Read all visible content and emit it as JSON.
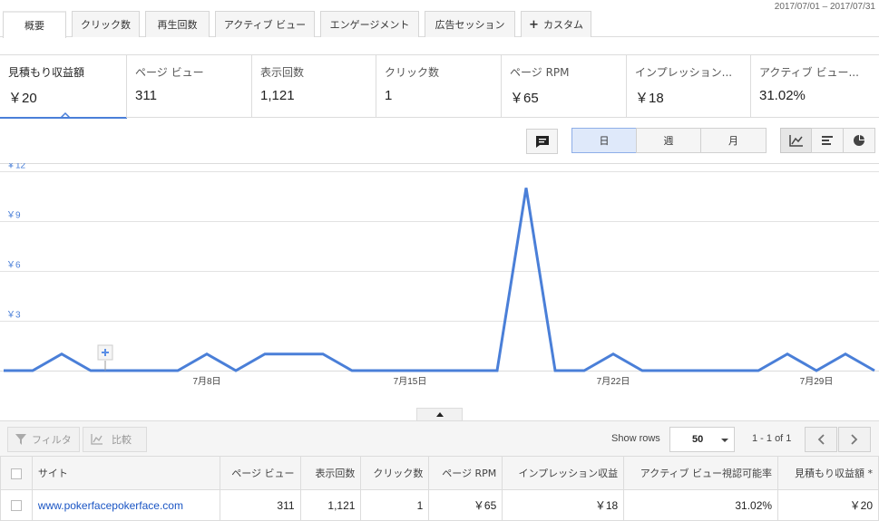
{
  "date_range": "2017/07/01 – 2017/07/31",
  "tabs": [
    {
      "label": "概要",
      "active": true
    },
    {
      "label": "クリック数"
    },
    {
      "label": "再生回数"
    },
    {
      "label": "アクティブ ビュー"
    },
    {
      "label": "エンゲージメント"
    },
    {
      "label": "広告セッション"
    },
    {
      "label": "カスタム",
      "icon": "plus-icon"
    }
  ],
  "metrics": [
    {
      "label": "見積もり収益額",
      "value": "￥20",
      "active": true
    },
    {
      "label": "ページ ビュー",
      "value": "311"
    },
    {
      "label": "表示回数",
      "value": "1,121"
    },
    {
      "label": "クリック数",
      "value": "1"
    },
    {
      "label": "ページ RPM",
      "value": "￥65"
    },
    {
      "label": "インプレッション...",
      "value": "￥18"
    },
    {
      "label": "アクティブ ビュー...",
      "value": "31.02%"
    }
  ],
  "toolbar": {
    "annotation_icon": "comment-icon",
    "period": {
      "day": "日",
      "week": "週",
      "month": "月",
      "selected": "day"
    },
    "chart_types": [
      "line-chart-icon",
      "bar-chart-icon",
      "pie-chart-icon"
    ],
    "selected_chart_type": "line-chart-icon"
  },
  "chart_data": {
    "type": "line",
    "x": [
      "7/1",
      "7/2",
      "7/3",
      "7/4",
      "7/5",
      "7/6",
      "7/7",
      "7/8",
      "7/9",
      "7/10",
      "7/11",
      "7/12",
      "7/13",
      "7/14",
      "7/15",
      "7/16",
      "7/17",
      "7/18",
      "7/19",
      "7/20",
      "7/21",
      "7/22",
      "7/23",
      "7/24",
      "7/25",
      "7/26",
      "7/27",
      "7/28",
      "7/29",
      "7/30",
      "7/31"
    ],
    "values": [
      0,
      0,
      1,
      0,
      0,
      0,
      0,
      1,
      0,
      1,
      1,
      1,
      0,
      0,
      0,
      0,
      0,
      0,
      11,
      0,
      0,
      1,
      0,
      0,
      0,
      0,
      0,
      1,
      0,
      1,
      0
    ],
    "yticks": [
      "￥3",
      "￥6",
      "￥9",
      "￥12"
    ],
    "ytick_values": [
      3,
      6,
      9,
      12
    ],
    "xticks": [
      "7月8日",
      "7月15日",
      "7月22日",
      "7月29日"
    ],
    "xtick_index": [
      7,
      14,
      21,
      28
    ],
    "ylim": [
      0,
      12
    ],
    "grid": true,
    "color": "#4a7fd8",
    "annotation_marker_index": 3.5
  },
  "table_toolbar": {
    "filter_label": "フィルタ",
    "compare_label": "比較",
    "show_rows_label": "Show rows",
    "rows_value": "50",
    "pager_text": "1 - 1 of 1"
  },
  "table": {
    "headers": [
      "サイト",
      "ページ ビュー",
      "表示回数",
      "クリック数",
      "ページ RPM",
      "インプレッション収益",
      "アクティブ ビュー視認可能率",
      "見積もり収益額 *"
    ],
    "rows": [
      [
        "www.pokerfacepokerface.com",
        "311",
        "1,121",
        "1",
        "￥65",
        "￥18",
        "31.02%",
        "￥20"
      ]
    ]
  }
}
